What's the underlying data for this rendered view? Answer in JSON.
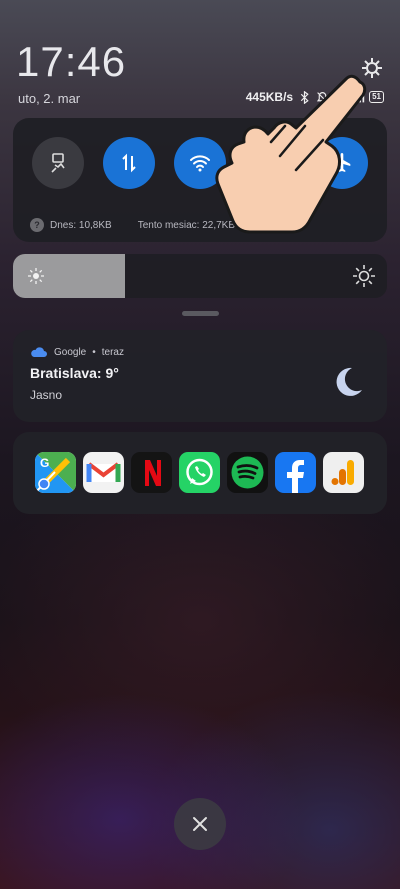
{
  "header": {
    "time": "17:46",
    "date": "uto, 2. mar",
    "network_speed": "445KB/s",
    "battery_level": "51"
  },
  "quick_toggles": {
    "items": [
      {
        "icon": "running-man-icon",
        "state": "off"
      },
      {
        "icon": "mobile-data-icon",
        "state": "on"
      },
      {
        "icon": "wifi-icon",
        "state": "on"
      },
      {
        "icon": "hidden-toggle-icon",
        "state": "on"
      },
      {
        "icon": "airplane-mode-icon",
        "state": "on"
      }
    ],
    "usage_today": "Dnes: 10,8KB",
    "usage_month": "Tento mesiac: 22,7KB",
    "help_glyph": "?"
  },
  "brightness": {
    "level_fraction": 0.3
  },
  "notification": {
    "app": "Google",
    "dot": "•",
    "time": "teraz",
    "title": "Bratislava: 9°",
    "text": "Jasno"
  },
  "app_shortcuts": [
    {
      "name": "Google Maps",
      "icon": "google-maps-icon"
    },
    {
      "name": "Gmail",
      "icon": "gmail-icon"
    },
    {
      "name": "Netflix",
      "icon": "netflix-icon"
    },
    {
      "name": "WhatsApp",
      "icon": "whatsapp-icon"
    },
    {
      "name": "Spotify",
      "icon": "spotify-icon"
    },
    {
      "name": "Facebook",
      "icon": "facebook-icon"
    },
    {
      "name": "Google Analytics",
      "icon": "google-analytics-icon"
    }
  ],
  "colors": {
    "toggle_on": "#1a73d6",
    "toggle_off": "#3a3a40"
  }
}
